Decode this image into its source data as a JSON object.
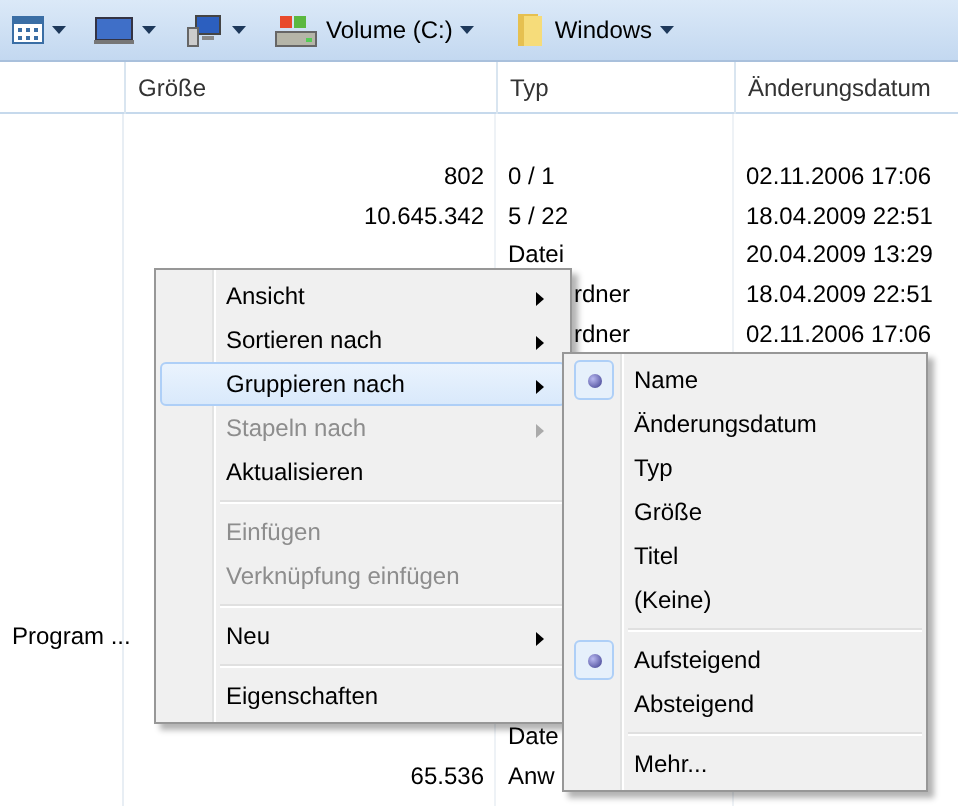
{
  "toolbar": [
    {
      "kind": "view"
    },
    {
      "kind": "desktop"
    },
    {
      "kind": "computer"
    },
    {
      "kind": "drive",
      "label": "Volume (C:)"
    },
    {
      "kind": "folder",
      "label": "Windows"
    }
  ],
  "columns": [
    "Größe",
    "Typ",
    "Änderungsdatum"
  ],
  "rows_top": [
    {
      "size": "802",
      "type": "0 / 1",
      "modified": "02.11.2006 17:06"
    },
    {
      "size": "10.645.342",
      "type": "5 / 22",
      "modified": "18.04.2009 22:51"
    },
    {
      "type": "Datei",
      "modified": "20.04.2009 13:29"
    },
    {
      "type": "rdner",
      "covered": true,
      "modified": "18.04.2009 22:51"
    },
    {
      "type": "rdner",
      "covered": true,
      "modified": "02.11.2006 17:06"
    }
  ],
  "rows_middle": [
    {
      "name": "Program ..."
    }
  ],
  "rows_bottom": [
    {
      "type": "Date"
    },
    {
      "size": "65.536",
      "type": "Anw"
    }
  ],
  "context_menu": [
    {
      "kind": "item",
      "label": "Ansicht",
      "submenu": true,
      "disabled": false,
      "selected": false
    },
    {
      "kind": "item",
      "label": "Sortieren nach",
      "submenu": true,
      "disabled": false,
      "selected": false
    },
    {
      "kind": "item",
      "label": "Gruppieren nach",
      "submenu": true,
      "disabled": false,
      "selected": true
    },
    {
      "kind": "item",
      "label": "Stapeln nach",
      "submenu": true,
      "disabled": true,
      "selected": false
    },
    {
      "kind": "item",
      "label": "Aktualisieren",
      "submenu": false,
      "disabled": false,
      "selected": false
    },
    {
      "kind": "separator"
    },
    {
      "kind": "item",
      "label": "Einfügen",
      "submenu": false,
      "disabled": true,
      "selected": false
    },
    {
      "kind": "item",
      "label": "Verknüpfung einfügen",
      "submenu": false,
      "disabled": true,
      "selected": false
    },
    {
      "kind": "separator"
    },
    {
      "kind": "item",
      "label": "Neu",
      "submenu": true,
      "disabled": false,
      "selected": false
    },
    {
      "kind": "separator"
    },
    {
      "kind": "item",
      "label": "Eigenschaften",
      "submenu": false,
      "disabled": false,
      "selected": false
    }
  ],
  "submenu": [
    {
      "kind": "item",
      "label": "Name",
      "checked": true
    },
    {
      "kind": "item",
      "label": "Änderungsdatum",
      "checked": false
    },
    {
      "kind": "item",
      "label": "Typ",
      "checked": false
    },
    {
      "kind": "item",
      "label": "Größe",
      "checked": false
    },
    {
      "kind": "item",
      "label": "Titel",
      "checked": false
    },
    {
      "kind": "item",
      "label": "(Keine)",
      "checked": false
    },
    {
      "kind": "separator"
    },
    {
      "kind": "item",
      "label": "Aufsteigend",
      "checked": true
    },
    {
      "kind": "item",
      "label": "Absteigend",
      "checked": false
    },
    {
      "kind": "separator"
    },
    {
      "kind": "item",
      "label": "Mehr...",
      "checked": false
    }
  ]
}
